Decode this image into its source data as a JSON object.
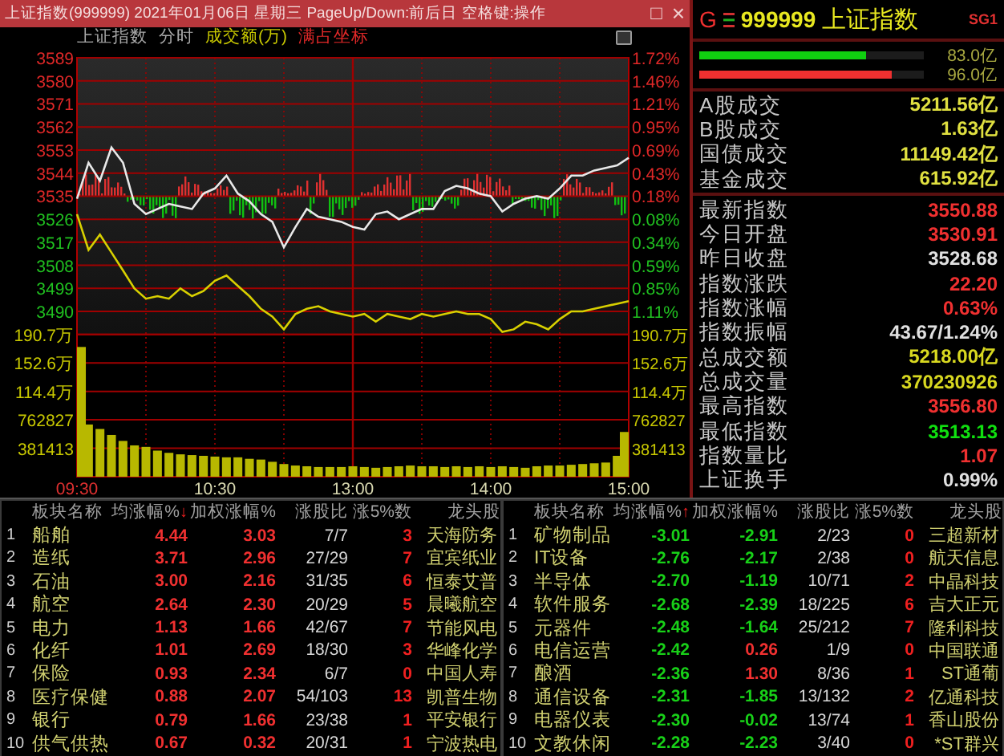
{
  "window": {
    "title": "上证指数(999999) 2021年01月06日 星期三 PageUp/Down:前后日 空格键:操作",
    "controls": [
      {
        "kind": "maximize",
        "label": "□"
      },
      {
        "kind": "close",
        "label": "×"
      }
    ]
  },
  "chart_header": {
    "items": [
      {
        "label": "上证指数",
        "color": "#a8a8a8"
      },
      {
        "label": "分时",
        "color": "#a8a8a8"
      },
      {
        "label": "成交额(万)",
        "color": "#c8c800"
      },
      {
        "label": "满占坐标",
        "color": "#e02828"
      }
    ]
  },
  "price_chart": {
    "left_axis": [
      {
        "label": "3589",
        "color": "#e02828"
      },
      {
        "label": "3580",
        "color": "#e02828"
      },
      {
        "label": "3571",
        "color": "#e02828"
      },
      {
        "label": "3562",
        "color": "#e02828"
      },
      {
        "label": "3553",
        "color": "#e02828"
      },
      {
        "label": "3544",
        "color": "#e02828"
      },
      {
        "label": "3535",
        "color": "#e02828"
      },
      {
        "label": "3526",
        "color": "#20c020"
      },
      {
        "label": "3517",
        "color": "#20c020"
      },
      {
        "label": "3508",
        "color": "#20c020"
      },
      {
        "label": "3499",
        "color": "#20c020"
      },
      {
        "label": "3490",
        "color": "#20c020"
      }
    ],
    "right_axis": [
      {
        "label": "1.72%",
        "color": "#e02828"
      },
      {
        "label": "1.46%",
        "color": "#e02828"
      },
      {
        "label": "1.21%",
        "color": "#e02828"
      },
      {
        "label": "0.95%",
        "color": "#e02828"
      },
      {
        "label": "0.69%",
        "color": "#e02828"
      },
      {
        "label": "0.43%",
        "color": "#e02828"
      },
      {
        "label": "0.18%",
        "color": "#e02828"
      },
      {
        "label": "0.08%",
        "color": "#20c020"
      },
      {
        "label": "0.34%",
        "color": "#20c020"
      },
      {
        "label": "0.59%",
        "color": "#20c020"
      },
      {
        "label": "0.85%",
        "color": "#20c020"
      },
      {
        "label": "1.11%",
        "color": "#20c020"
      }
    ],
    "chart_data": {
      "type": "line",
      "grid": true,
      "ylim": [
        3481,
        3589
      ],
      "yticks": [
        3589,
        3580,
        3571,
        3562,
        3553,
        3544,
        3535,
        3526,
        3517,
        3508,
        3499,
        3490
      ],
      "series": [
        {
          "color": "#e8e8e8",
          "values": [
            3534,
            3548,
            3541,
            3554,
            3548,
            3532,
            3528,
            3530,
            3532,
            3531,
            3530,
            3536,
            3538,
            3543,
            3536,
            3533,
            3528,
            3525,
            3515,
            3523,
            3530,
            3527,
            3526,
            3525,
            3523,
            3522,
            3528,
            3529,
            3526,
            3528,
            3530,
            3530,
            3537,
            3539,
            3538,
            3536,
            3535,
            3529,
            3532,
            3534,
            3535,
            3534,
            3538,
            3543,
            3543,
            3545,
            3546,
            3547,
            3550
          ]
        },
        {
          "color": "#d8d000",
          "values": [
            3528,
            3514,
            3520,
            3513,
            3506,
            3499,
            3495,
            3496,
            3495,
            3499,
            3496,
            3498,
            3502,
            3504,
            3500,
            3496,
            3491,
            3488,
            3483,
            3489,
            3491,
            3492,
            3490,
            3489,
            3488,
            3489,
            3486,
            3489,
            3488,
            3487,
            3489,
            3488,
            3489,
            3490,
            3489,
            3489,
            3487,
            3482,
            3483,
            3486,
            3485,
            3483,
            3487,
            3490,
            3490,
            3491,
            3492,
            3493,
            3494
          ]
        }
      ]
    }
  },
  "volume_chart": {
    "left_axis": [
      "190.7万",
      "152.6万",
      "114.4万",
      "762827",
      "381413"
    ],
    "right_axis": [
      "190.7万",
      "152.6万",
      "114.4万",
      "762827",
      "381413"
    ],
    "chart_data": {
      "type": "bar",
      "categories": [
        "09:30",
        null,
        null,
        null,
        null,
        null,
        null,
        null,
        null,
        null,
        null,
        null,
        "10:30",
        null,
        null,
        null,
        null,
        null,
        null,
        null,
        null,
        null,
        null,
        null,
        "13:00",
        null,
        null,
        null,
        null,
        null,
        null,
        null,
        null,
        null,
        null,
        null,
        "14:00",
        null,
        null,
        null,
        null,
        null,
        null,
        null,
        null,
        null,
        null,
        null,
        "15:00"
      ],
      "grid": true,
      "ylim": [
        0,
        1907065
      ],
      "yticks": [
        762827,
        381413
      ],
      "series": [
        {
          "color": "#b8b800",
          "values": [
            1740000,
            700000,
            640000,
            560000,
            480000,
            420000,
            400000,
            350000,
            320000,
            300000,
            290000,
            280000,
            270000,
            260000,
            260000,
            240000,
            230000,
            200000,
            170000,
            150000,
            140000,
            130000,
            130000,
            130000,
            140000,
            130000,
            120000,
            130000,
            140000,
            150000,
            140000,
            140000,
            130000,
            140000,
            130000,
            140000,
            130000,
            140000,
            130000,
            120000,
            140000,
            150000,
            150000,
            160000,
            170000,
            180000,
            190000,
            280000,
            600000
          ]
        }
      ]
    }
  },
  "quote": {
    "market": "G",
    "code": "999999",
    "name": "上证指数",
    "tag": "SG1",
    "flow_bars": [
      {
        "level": 0.74,
        "color": "#10d010",
        "value": "83.0亿"
      },
      {
        "level": 0.86,
        "color": "#f03030",
        "value": "96.0亿"
      }
    ],
    "turnover": [
      {
        "label": "A股成交",
        "value": "5211.56亿"
      },
      {
        "label": "B股成交",
        "value": "1.63亿"
      },
      {
        "label": "国债成交",
        "value": "11149.42亿"
      },
      {
        "label": "基金成交",
        "value": "615.92亿"
      }
    ],
    "stats": [
      {
        "label": "最新指数",
        "value": "3550.88",
        "color": "#f03030"
      },
      {
        "label": "今日开盘",
        "value": "3530.91",
        "color": "#f03030"
      },
      {
        "label": "昨日收盘",
        "value": "3528.68",
        "color": "#e0e0e0"
      },
      {
        "label": "指数涨跌",
        "value": "22.20",
        "color": "#f03030"
      },
      {
        "label": "指数涨幅",
        "value": "0.63%",
        "color": "#f03030"
      },
      {
        "label": "指数振幅",
        "value": "43.67/1.24%",
        "color": "#e0e0e0"
      },
      {
        "label": "总成交额",
        "value": "5218.00亿",
        "color": "#d8d820"
      },
      {
        "label": "总成交量",
        "value": "370230926",
        "color": "#d8d820"
      },
      {
        "label": "最高指数",
        "value": "3556.80",
        "color": "#f03030"
      },
      {
        "label": "最低指数",
        "value": "3513.13",
        "color": "#10e010"
      },
      {
        "label": "指数量比",
        "value": "1.07",
        "color": "#f03030"
      },
      {
        "label": "上证换手",
        "value": "0.99%",
        "color": "#e0e0e0"
      }
    ]
  },
  "sector_tables": [
    {
      "columns": [
        {
          "label": "板块名称"
        },
        {
          "label": "均涨幅%",
          "sort_mark": "↓"
        },
        {
          "label": "加权涨幅%"
        },
        {
          "label": "涨股比"
        },
        {
          "label": "涨5%数"
        },
        {
          "label": "龙头股"
        }
      ],
      "rows": [
        {
          "rank": "1",
          "name": "船舶",
          "avg": "4.44",
          "weighted": "3.03",
          "ratio": "7/7",
          "up5": "3",
          "leader": "天海防务"
        },
        {
          "rank": "2",
          "name": "造纸",
          "avg": "3.71",
          "weighted": "2.96",
          "ratio": "27/29",
          "up5": "7",
          "leader": "宜宾纸业"
        },
        {
          "rank": "3",
          "name": "石油",
          "avg": "3.00",
          "weighted": "2.16",
          "ratio": "31/35",
          "up5": "6",
          "leader": "恒泰艾普"
        },
        {
          "rank": "4",
          "name": "航空",
          "avg": "2.64",
          "weighted": "2.30",
          "ratio": "20/29",
          "up5": "5",
          "leader": "晨曦航空"
        },
        {
          "rank": "5",
          "name": "电力",
          "avg": "1.13",
          "weighted": "1.66",
          "ratio": "42/67",
          "up5": "7",
          "leader": "节能风电"
        },
        {
          "rank": "6",
          "name": "化纤",
          "avg": "1.01",
          "weighted": "2.69",
          "ratio": "18/30",
          "up5": "3",
          "leader": "华峰化学"
        },
        {
          "rank": "7",
          "name": "保险",
          "avg": "0.93",
          "weighted": "2.34",
          "ratio": "6/7",
          "up5": "0",
          "leader": "中国人寿"
        },
        {
          "rank": "8",
          "name": "医疗保健",
          "avg": "0.88",
          "weighted": "2.07",
          "ratio": "54/103",
          "up5": "13",
          "leader": "凯普生物"
        },
        {
          "rank": "9",
          "name": "银行",
          "avg": "0.79",
          "weighted": "1.66",
          "ratio": "23/38",
          "up5": "1",
          "leader": "平安银行"
        },
        {
          "rank": "10",
          "name": "供气供热",
          "avg": "0.67",
          "weighted": "0.32",
          "ratio": "20/31",
          "up5": "1",
          "leader": "宁波热电"
        }
      ]
    },
    {
      "columns": [
        {
          "label": "板块名称"
        },
        {
          "label": "均涨幅%",
          "sort_mark": "↑"
        },
        {
          "label": "加权涨幅%"
        },
        {
          "label": "涨股比"
        },
        {
          "label": "涨5%数"
        },
        {
          "label": "龙头股"
        }
      ],
      "rows": [
        {
          "rank": "1",
          "name": "矿物制品",
          "avg": "-3.01",
          "weighted": "-2.91",
          "ratio": "2/23",
          "up5": "0",
          "leader": "三超新材"
        },
        {
          "rank": "2",
          "name": "IT设备",
          "avg": "-2.76",
          "weighted": "-2.17",
          "ratio": "2/38",
          "up5": "0",
          "leader": "航天信息"
        },
        {
          "rank": "3",
          "name": "半导体",
          "avg": "-2.70",
          "weighted": "-1.19",
          "ratio": "10/71",
          "up5": "2",
          "leader": "中晶科技"
        },
        {
          "rank": "4",
          "name": "软件服务",
          "avg": "-2.68",
          "weighted": "-2.39",
          "ratio": "18/225",
          "up5": "6",
          "leader": "吉大正元"
        },
        {
          "rank": "5",
          "name": "元器件",
          "avg": "-2.48",
          "weighted": "-1.64",
          "ratio": "25/212",
          "up5": "7",
          "leader": "隆利科技"
        },
        {
          "rank": "6",
          "name": "电信运营",
          "avg": "-2.42",
          "weighted": "0.26",
          "ratio": "1/9",
          "up5": "0",
          "leader": "中国联通"
        },
        {
          "rank": "7",
          "name": "酿酒",
          "avg": "-2.36",
          "weighted": "1.30",
          "ratio": "8/36",
          "up5": "1",
          "leader": "ST通葡"
        },
        {
          "rank": "8",
          "name": "通信设备",
          "avg": "-2.31",
          "weighted": "-1.85",
          "ratio": "13/132",
          "up5": "2",
          "leader": "亿通科技"
        },
        {
          "rank": "9",
          "name": "电器仪表",
          "avg": "-2.30",
          "weighted": "-0.02",
          "ratio": "13/74",
          "up5": "1",
          "leader": "香山股份"
        },
        {
          "rank": "10",
          "name": "文教休闲",
          "avg": "-2.28",
          "weighted": "-2.23",
          "ratio": "3/40",
          "up5": "0",
          "leader": "*ST群兴"
        }
      ]
    }
  ]
}
